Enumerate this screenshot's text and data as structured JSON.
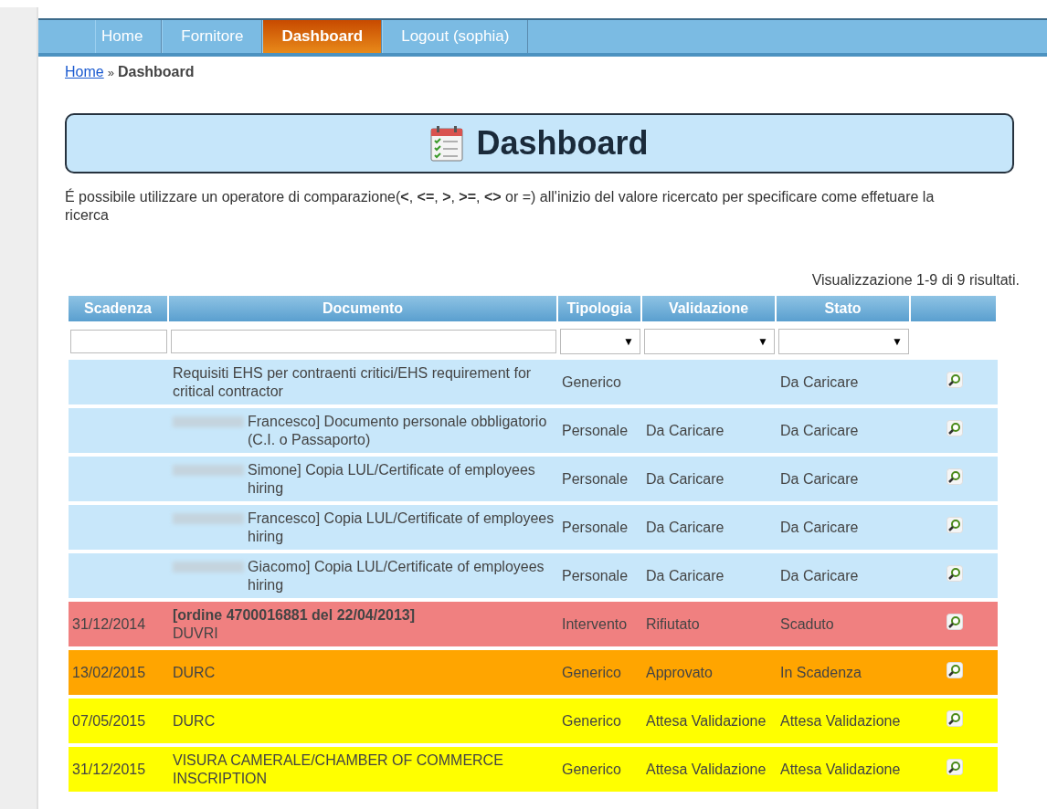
{
  "nav": [
    {
      "label": "Home",
      "selected": false
    },
    {
      "label": "Fornitore",
      "selected": false
    },
    {
      "label": "Dashboard",
      "selected": true
    },
    {
      "label": "Logout (sophia)",
      "selected": false
    }
  ],
  "breadcrumb": {
    "link": "Home",
    "separator": "»",
    "current": "Dashboard"
  },
  "title": "Dashboard",
  "hint": "É possibile utilizzare un operatore di comparazione(**<**, **<=**, **>**, **>=**, **<>** or =) all'inizio del valore ricercato per specificare come effetuare la ricerca",
  "summary": "Visualizzazione 1-9 di 9 risultati.",
  "columns": [
    {
      "label": "Scadenza",
      "kind": "text"
    },
    {
      "label": "Documento",
      "kind": "text"
    },
    {
      "label": "Tipologia",
      "kind": "select",
      "caret": "▼"
    },
    {
      "label": "Validazione",
      "kind": "select",
      "caret": "▼"
    },
    {
      "label": "Stato",
      "kind": "select",
      "caret": "▼"
    },
    {
      "kind": "blank"
    }
  ],
  "rows": [
    {
      "color": "#c8e7fa",
      "redacted": false,
      "document": "Requisiti EHS per contraenti critici/EHS requirement for critical contractor",
      "tipologia": "Generico",
      "stato": "Da Caricare"
    },
    {
      "color": "#c8e7fa",
      "redacted": true,
      "document": "Francesco] Documento personale obbligatorio (C.I. o Passaporto)",
      "tipologia": "Personale",
      "validazione": "Da Caricare",
      "stato": "Da Caricare"
    },
    {
      "color": "#c8e7fa",
      "redacted": true,
      "document": "Simone] Copia LUL/Certificate of employees hiring",
      "tipologia": "Personale",
      "validazione": "Da Caricare",
      "stato": "Da Caricare"
    },
    {
      "color": "#c8e7fa",
      "redacted": true,
      "document": "Francesco] Copia LUL/Certificate of employees hiring",
      "tipologia": "Personale",
      "validazione": "Da Caricare",
      "stato": "Da Caricare"
    },
    {
      "color": "#c8e7fa",
      "redacted": true,
      "document": "Giacomo] Copia LUL/Certificate of employees hiring",
      "tipologia": "Personale",
      "validazione": "Da Caricare",
      "stato": "Da Caricare"
    },
    {
      "color": "#f08080",
      "scadenza": "31/12/2014",
      "redacted": false,
      "document": "**[ordine 4700016881 del 22/04/2013]**\nDUVRI",
      "tipologia": "Intervento",
      "validazione": "Rifiutato",
      "stato": "Scaduto"
    },
    {
      "color": "#ffa500",
      "scadenza": "13/02/2015",
      "redacted": false,
      "document": "DURC",
      "tipologia": "Generico",
      "validazione": "Approvato",
      "stato": "In Scadenza"
    },
    {
      "color": "#ffff00",
      "scadenza": "07/05/2015",
      "redacted": false,
      "document": "DURC",
      "tipologia": "Generico",
      "validazione": "Attesa Validazione",
      "stato": "Attesa Validazione"
    },
    {
      "color": "#ffff00",
      "scadenza": "31/12/2015",
      "redacted": false,
      "document": "VISURA CAMERALE/CHAMBER OF COMMERCE INSCRIPTION",
      "tipologia": "Generico",
      "validazione": "Attesa Validazione",
      "stato": "Attesa Validazione"
    }
  ]
}
